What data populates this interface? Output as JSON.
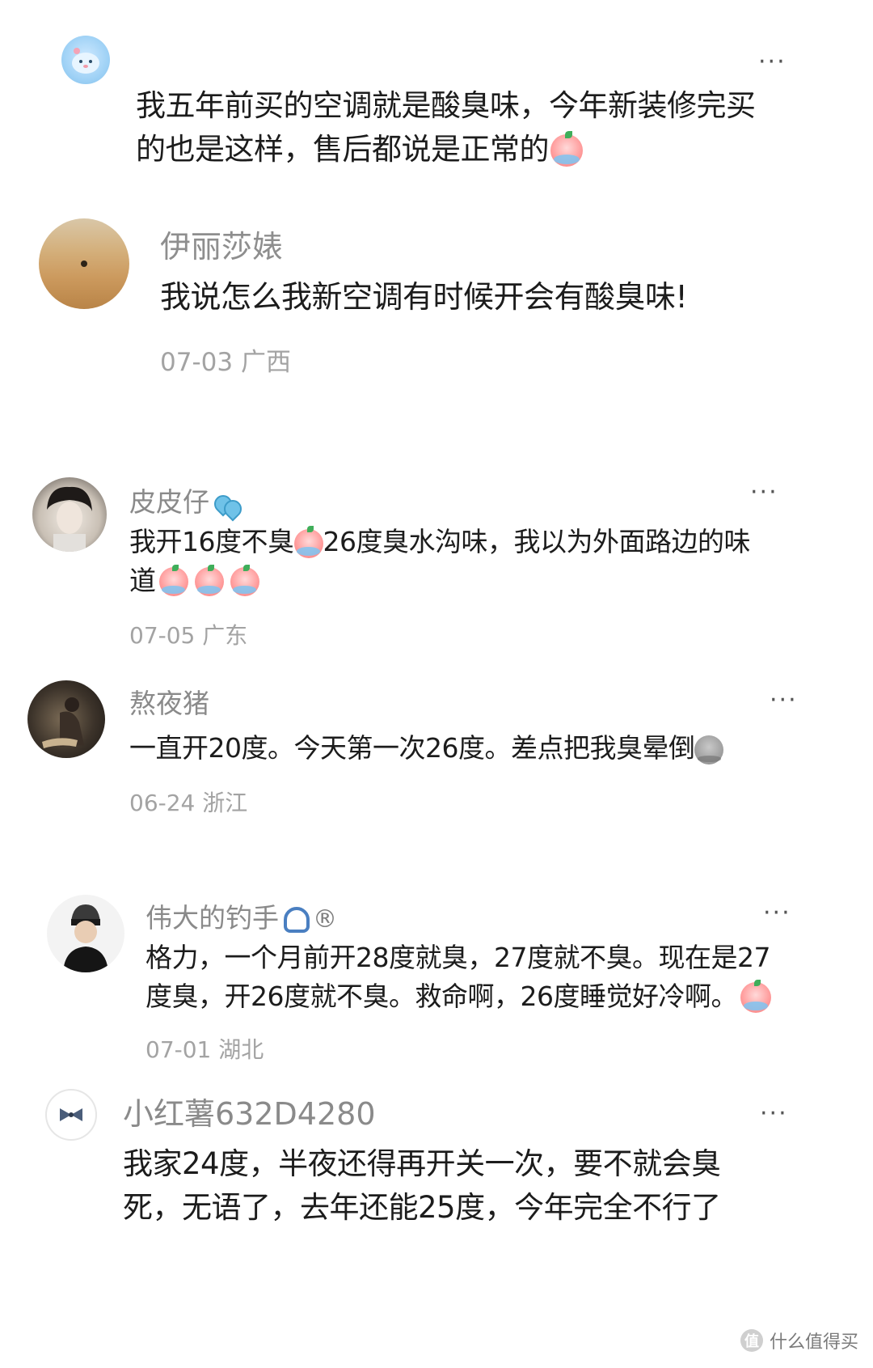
{
  "comments": [
    {
      "username": "",
      "text_parts": [
        "我五年前买的空调就是酸臭味，今年新装修完买的也是这样，售后都说是正常的"
      ],
      "date": "",
      "location": "",
      "more": "···"
    },
    {
      "username": "伊丽莎婊",
      "text_parts": [
        "我说怎么我新空调有时候开会有酸臭味!"
      ],
      "date": "07-03",
      "location": "广西",
      "more": ""
    },
    {
      "username": "皮皮仔",
      "text_parts": [
        "我开16度不臭",
        "26度臭水沟味，我以为外面路边的味道"
      ],
      "date": "07-05",
      "location": "广东",
      "more": "···"
    },
    {
      "username": "熬夜猪",
      "text_parts": [
        "一直开20度。今天第一次26度。差点把我臭晕倒"
      ],
      "date": "06-24",
      "location": "浙江",
      "more": "···"
    },
    {
      "username": "伟大的钓手",
      "username_suffix": "®",
      "text_parts": [
        "格力，一个月前开28度就臭，27度就不臭。现在是27度臭，开26度就不臭。救命啊，26度睡觉好冷啊。"
      ],
      "date": "07-01",
      "location": "湖北",
      "more": "···"
    },
    {
      "username": "小红薯632D4280",
      "text_parts": [
        "我家24度，半夜还得再开关一次，要不就会臭死，无语了，去年还能25度，今年完全不行了"
      ],
      "date": "",
      "location": "",
      "more": "···"
    }
  ],
  "watermark": {
    "text": "什么值得买",
    "icon": "值"
  },
  "icons": {
    "cry_emoji": "crying-face-emoji",
    "faint_emoji": "fainting-face-emoji",
    "more": "more-dots-icon"
  }
}
